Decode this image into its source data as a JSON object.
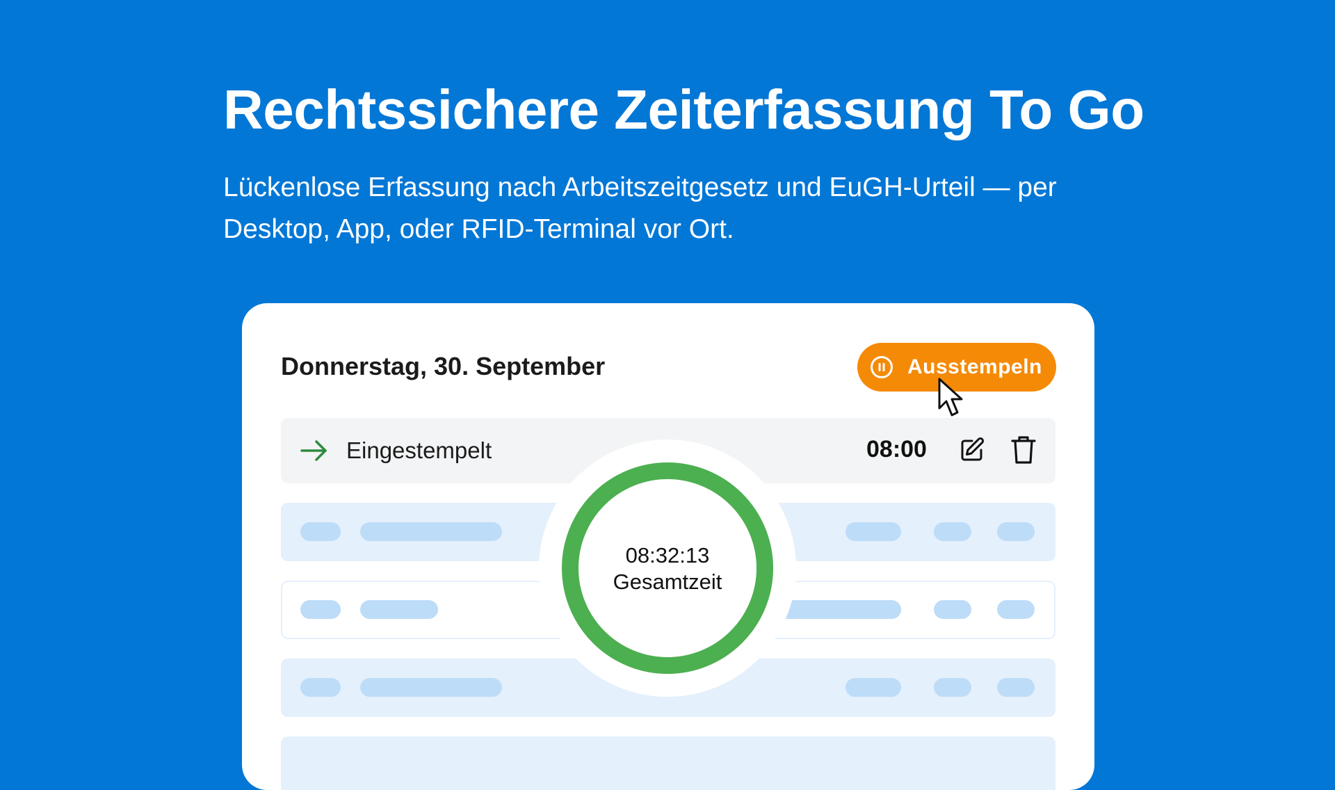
{
  "hero": {
    "headline": "Rechtssichere Zeiterfassung To Go",
    "subline": "Lückenlose Erfassung nach Arbeitszeitgesetz und EuGH-Urteil — per Desktop, App, oder RFID-Terminal vor Ort."
  },
  "card": {
    "date": "Donnerstag, 30. September",
    "stamp_button": {
      "label": "Ausstempeln",
      "icon": "pause-circle-icon"
    },
    "entry": {
      "icon": "arrow-right-icon",
      "label": "Eingestempelt",
      "time": "08:00",
      "actions": [
        "edit-icon",
        "trash-icon"
      ]
    },
    "timer": {
      "value": "08:32:13",
      "label": "Gesamtzeit"
    }
  },
  "colors": {
    "background": "#0277D6",
    "accent": "#F58A07",
    "ring": "#4CAF50",
    "entry_arrow": "#2E8B3E",
    "skeleton_row": "#E4F0FC",
    "skeleton_pill": "#BDDCF8"
  }
}
